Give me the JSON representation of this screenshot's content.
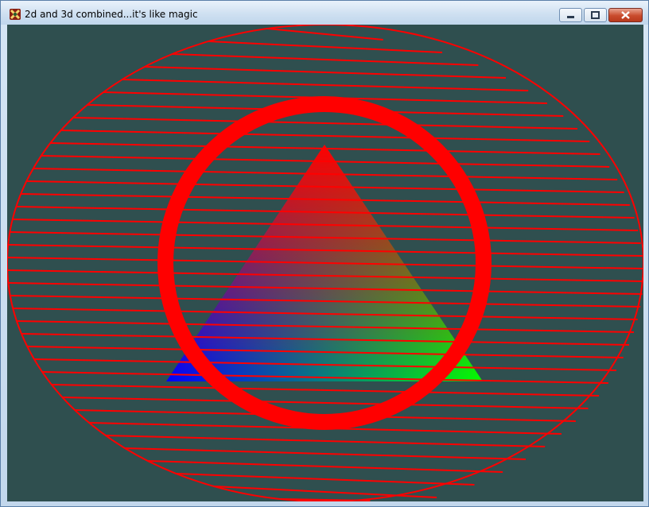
{
  "window": {
    "title": "2d and 3d combined...it's like magic",
    "icon": "app-logo-icon"
  },
  "controls": {
    "minimize_icon": "minimize-icon",
    "maximize_icon": "maximize-icon",
    "close_icon": "close-icon"
  },
  "scene": {
    "background_color": "#2f4f4f",
    "shape_color": "#ff0000",
    "triangle_colors": {
      "top": "#ff0000",
      "left": "#0000ff",
      "right": "#00ff00"
    }
  }
}
